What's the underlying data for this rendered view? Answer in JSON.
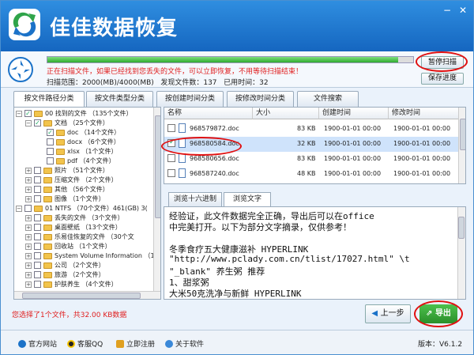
{
  "app": {
    "title": "佳佳数据恢复",
    "version_label": "版本：",
    "version": "V6.1.2"
  },
  "colors": {
    "accent": "#1b72c8",
    "warning": "#e02020",
    "progress": "#3fb53f",
    "next_button": "#34a334"
  },
  "scan": {
    "progress": 0.96,
    "message": "正在扫描文件，如果已经找到您丢失的文件，可以立即恢复，不用等待扫描结束！",
    "range": "扫描范围：2000(MB)/4000(MB)",
    "found": "发现文件数：137",
    "elapsed": "已用时间：32",
    "pause_label": "暂停扫描",
    "save_label": "保存进度"
  },
  "tabs": [
    "按文件路径分类",
    "按文件类型分类",
    "按创建时间分类",
    "按修改时间分类",
    "文件搜索"
  ],
  "tree": [
    {
      "label": "00 找到的文件 （135个文件）",
      "depth": 0,
      "exp": "−",
      "checked": true,
      "folder": true
    },
    {
      "label": "文档 （25个文件）",
      "depth": 1,
      "exp": "−",
      "checked": true,
      "folder": true
    },
    {
      "label": "doc （14个文件）",
      "depth": 2,
      "exp": "",
      "checked": true,
      "folder": true
    },
    {
      "label": "docx （6个文件）",
      "depth": 2,
      "exp": "",
      "checked": false,
      "folder": true
    },
    {
      "label": "xlsx （1个文件）",
      "depth": 2,
      "exp": "",
      "checked": false,
      "folder": true
    },
    {
      "label": "pdf （4个文件）",
      "depth": 2,
      "exp": "",
      "checked": false,
      "folder": true
    },
    {
      "label": "照片 （51个文件）",
      "depth": 1,
      "exp": "+",
      "checked": false,
      "folder": true
    },
    {
      "label": "压缩文件 （2个文件）",
      "depth": 1,
      "exp": "+",
      "checked": false,
      "folder": true
    },
    {
      "label": "其他 （56个文件）",
      "depth": 1,
      "exp": "+",
      "checked": false,
      "folder": true
    },
    {
      "label": "图像 （1个文件）",
      "depth": 1,
      "exp": "+",
      "checked": false,
      "folder": true
    },
    {
      "label": "01 NTFS （70个文件）461(GB) 3(",
      "depth": 0,
      "exp": "−",
      "checked": false,
      "folder": true
    },
    {
      "label": "丢失的文件 （3个文件）",
      "depth": 1,
      "exp": "+",
      "checked": false,
      "folder": true
    },
    {
      "label": "桌面壁纸 （13个文件）",
      "depth": 1,
      "exp": "+",
      "checked": false,
      "folder": true
    },
    {
      "label": "乐易佳恢复的文件 （30个文",
      "depth": 1,
      "exp": "+",
      "checked": false,
      "folder": true
    },
    {
      "label": "回收站 （1个文件）",
      "depth": 1,
      "exp": "+",
      "checked": false,
      "folder": true
    },
    {
      "label": "System Volume Information （1",
      "depth": 1,
      "exp": "+",
      "checked": false,
      "folder": true
    },
    {
      "label": "公司 （2个文件）",
      "depth": 1,
      "exp": "+",
      "checked": false,
      "folder": true
    },
    {
      "label": "旅游 （2个文件）",
      "depth": 1,
      "exp": "+",
      "checked": false,
      "folder": true
    },
    {
      "label": "护肤养生 （4个文件）",
      "depth": 1,
      "exp": "+",
      "checked": false,
      "folder": true
    }
  ],
  "filelist": {
    "columns": [
      "名称",
      "大小",
      "创建时间",
      "修改时间"
    ],
    "rows": [
      {
        "name": "968579872.doc",
        "size": "83 KB",
        "created": "1900-01-01 00:00",
        "modified": "1900-01-01 00:00",
        "checked": false,
        "selected": false
      },
      {
        "name": "968580584.doc",
        "size": "32 KB",
        "created": "1900-01-01 00:00",
        "modified": "1900-01-01 00:00",
        "checked": true,
        "selected": true
      },
      {
        "name": "968580656.doc",
        "size": "83 KB",
        "created": "1900-01-01 00:00",
        "modified": "1900-01-01 00:00",
        "checked": false,
        "selected": false
      },
      {
        "name": "968587240.doc",
        "size": "48 KB",
        "created": "1900-01-01 00:00",
        "modified": "1900-01-01 00:00",
        "checked": false,
        "selected": false
      }
    ]
  },
  "preview": {
    "tabs": [
      "浏览十六进制",
      "浏览文字"
    ],
    "lines": [
      "  经验证，此文件数据完全正确，导出后可以在office",
      "中完美打开。以下为部分文字摘录，仅供参考！",
      "",
      "冬季食疗五大健康滋补  HYPERLINK",
      "\"http://www.pclady.com.cn/tlist/17027.html\" \\t",
      "\"_blank\"  养生粥 推荐",
      "    1、甜浆粥",
      "    大米50克洗净与新鲜  HYPERLINK"
    ]
  },
  "status": "您选择了1个文件，共32.00 KB数据",
  "buttons": {
    "prev_label": "上一步",
    "export_label": "导出"
  },
  "footer": {
    "links": [
      "官方网站",
      "客服QQ",
      "立即注册",
      "关于软件"
    ]
  }
}
